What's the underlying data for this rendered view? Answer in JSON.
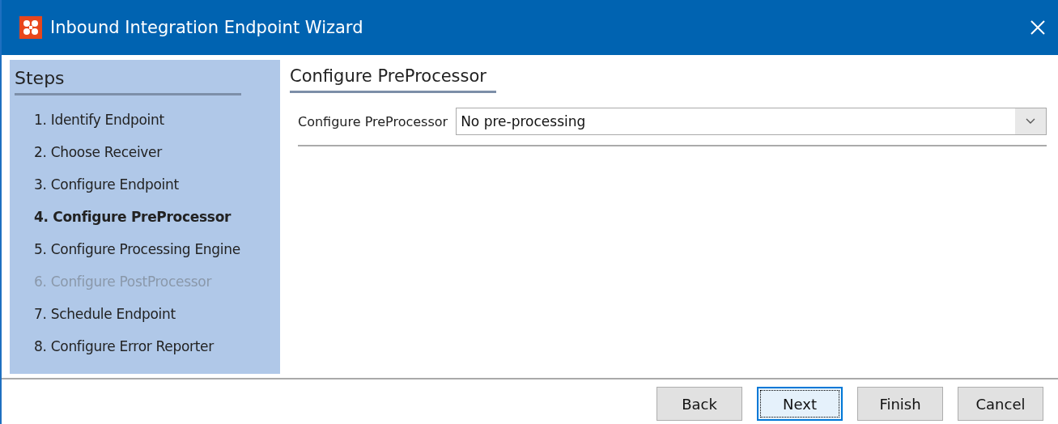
{
  "window": {
    "title": "Inbound Integration Endpoint Wizard"
  },
  "steps": {
    "title": "Steps",
    "items": [
      {
        "label": "1. Identify Endpoint",
        "current": false,
        "disabled": false
      },
      {
        "label": "2. Choose Receiver",
        "current": false,
        "disabled": false
      },
      {
        "label": "3. Configure Endpoint",
        "current": false,
        "disabled": false
      },
      {
        "label": "4. Configure PreProcessor",
        "current": true,
        "disabled": false
      },
      {
        "label": "5. Configure Processing Engine",
        "current": false,
        "disabled": false
      },
      {
        "label": "6. Configure PostProcessor",
        "current": false,
        "disabled": true
      },
      {
        "label": "7. Schedule Endpoint",
        "current": false,
        "disabled": false
      },
      {
        "label": "8. Configure Error Reporter",
        "current": false,
        "disabled": false
      }
    ]
  },
  "panel": {
    "title": "Configure PreProcessor",
    "field": {
      "label": "Configure PreProcessor",
      "value": "No pre-processing"
    }
  },
  "buttons": [
    {
      "label": "Back",
      "focused": false
    },
    {
      "label": "Next",
      "focused": true
    },
    {
      "label": "Finish",
      "focused": false
    },
    {
      "label": "Cancel",
      "focused": false
    }
  ]
}
